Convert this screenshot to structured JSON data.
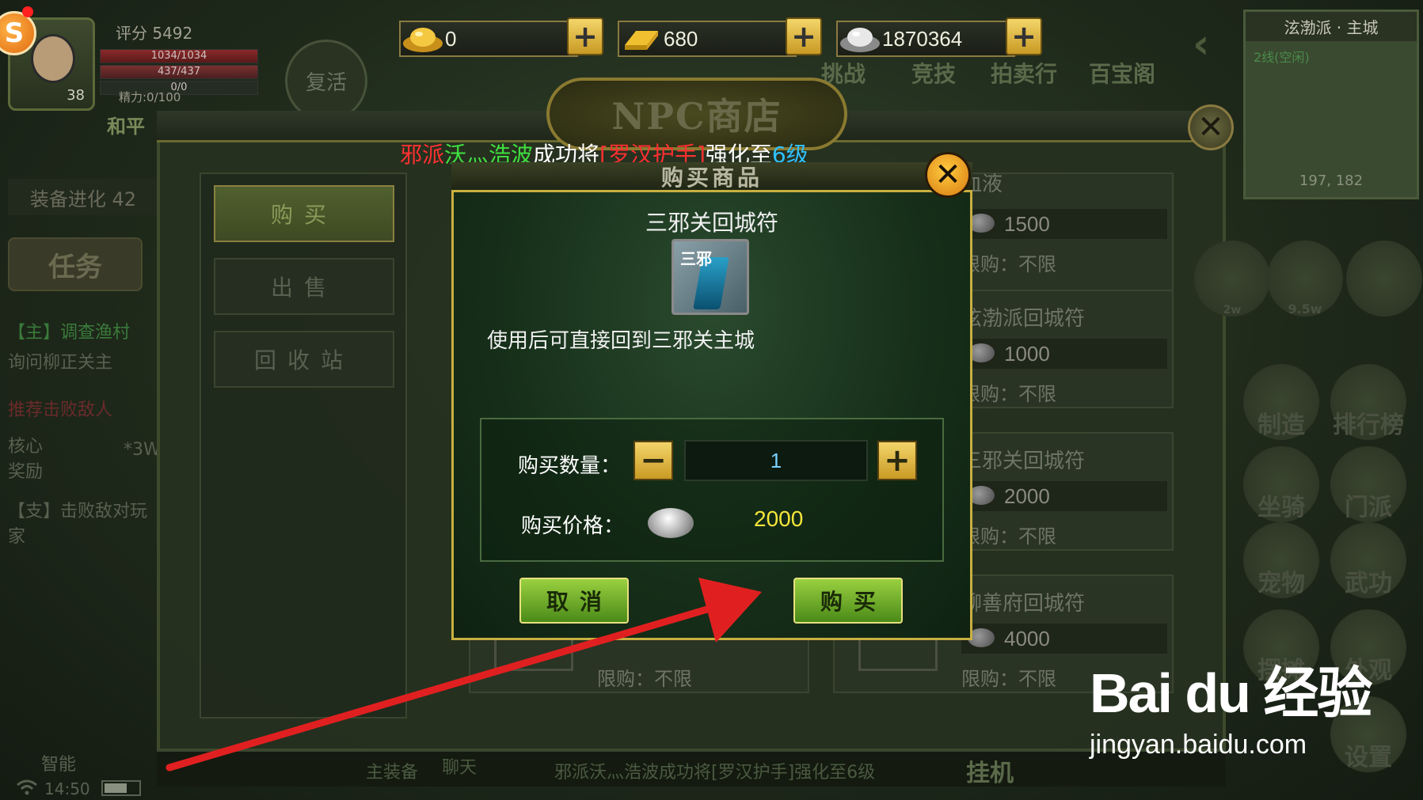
{
  "hud": {
    "score": "评分 5492",
    "hp": "1034/1034",
    "mp": "437/437",
    "stat3": "0/0",
    "energy": "精力:0/100",
    "level": "38",
    "pk_mode": "和平",
    "revive": "复活",
    "gold_ingot": "0",
    "gold_bar": "680",
    "silver": "1870364",
    "plus": "+",
    "coin_badge_letter": "S",
    "top_icons": [
      "挑战",
      "竞技",
      "拍卖行",
      "百宝阁"
    ]
  },
  "minimap": {
    "title": "泫渤派 · 主城",
    "line": "2线(空闲)",
    "coords": "197, 182"
  },
  "left_panel": {
    "evolve": "装备进化 42",
    "quest_btn": "任务",
    "quest1": "【主】调查渔村",
    "quest2": "询问柳正关主",
    "quest3": "推荐击败敌人",
    "reward_label": "核心奖励",
    "reward_value": "*3W",
    "quest4": "【支】击败敌对玩家",
    "auto": "智能"
  },
  "shop": {
    "title": "NPC商店",
    "tabs": [
      "购买",
      "出售",
      "回收站"
    ],
    "items": [
      {
        "name": "血液",
        "price": "1500",
        "limit": "限购：不限"
      },
      {
        "name": "泫渤派回城符",
        "price": "1000",
        "limit": "限购：不限"
      },
      {
        "name": "三邪关回城符",
        "price": "2000",
        "limit": "限购：不限"
      },
      {
        "name": "聊善府回城符",
        "price": "4000",
        "limit": "限购：不限"
      },
      {
        "name": "",
        "price": "",
        "limit": "限购：不限"
      }
    ]
  },
  "broadcast": {
    "part1": "邪派",
    "part2": "沃灬浩波",
    "part3": "成功将",
    "part4": "[罗汉护手]",
    "part5": "强化至",
    "part6": "6级"
  },
  "dialog": {
    "title": "购买商品",
    "item_name": "三邪关回城符",
    "item_tag": "三邪",
    "description": "使用后可直接回到三邪关主城",
    "qty_label": "购买数量：",
    "qty_value": "1",
    "price_label": "购买价格：",
    "price_value": "2000",
    "cancel": "取消",
    "confirm": "购买",
    "minus": "−",
    "plus": "+",
    "close": "✕"
  },
  "right_icons": [
    "制造",
    "排行榜",
    "坐骑",
    "门派",
    "宠物",
    "武功",
    "摆摊",
    "外观",
    "设置"
  ],
  "right_counts": [
    "2w",
    "9.5w"
  ],
  "bottom": {
    "equip": "主装备",
    "chat": "聊天",
    "ticker": "邪派沃灬浩波成功将[罗汉护手]强化至6级",
    "idle": "挂机",
    "time": "14:50"
  },
  "watermark": {
    "logo": "Bai du 经验",
    "url": "jingyan.baidu.com"
  },
  "colors": {
    "accent_gold": "#c8b040",
    "price_yellow": "#f6e63c",
    "arrow_red": "#e02020"
  }
}
